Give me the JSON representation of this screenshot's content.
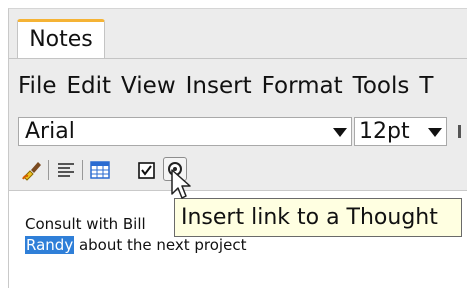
{
  "tab": {
    "label": "Notes"
  },
  "menu": {
    "items": [
      "File",
      "Edit",
      "View",
      "Insert",
      "Format",
      "Tools",
      "T"
    ]
  },
  "toolbar": {
    "font": "Arial",
    "size": "12pt",
    "icons": [
      "paint-brush-icon",
      "align-icon",
      "table-icon",
      "checkbox-icon",
      "thought-link-icon"
    ]
  },
  "editor": {
    "line1": "Consult with Bill",
    "line2_selected": "Randy",
    "line2_rest": " about the next project"
  },
  "tooltip": {
    "text": "Insert link to a Thought"
  },
  "colors": {
    "selection": "#2f7fd8",
    "tab_accent": "#f5b335",
    "tooltip_bg": "#ffffe1"
  }
}
